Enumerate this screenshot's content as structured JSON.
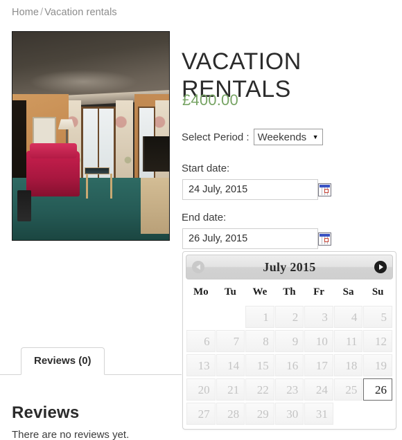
{
  "breadcrumb": {
    "home": "Home",
    "separator": "/",
    "current": "Vacation rentals"
  },
  "product": {
    "title": "VACATION RENTALS",
    "price": "£400.00",
    "price_color": "#77a464",
    "image_alt": "hotel-suite-interior"
  },
  "period": {
    "label": "Select Period :",
    "selected": "Weekends",
    "options": [
      "Weekends"
    ]
  },
  "start_date": {
    "label": "Start date:",
    "value": "24 July, 2015",
    "placeholder": "Start date"
  },
  "end_date": {
    "label": "End date:",
    "value": "26 July, 2015",
    "placeholder": "End date"
  },
  "datepicker": {
    "month_title": "July 2015",
    "prev_label": "Prev",
    "next_label": "Next",
    "weekdays": [
      "Mo",
      "Tu",
      "We",
      "Th",
      "Fr",
      "Sa",
      "Su"
    ],
    "selected_day": "26",
    "weeks": [
      [
        {
          "day": "",
          "state": "empty"
        },
        {
          "day": "",
          "state": "empty"
        },
        {
          "day": "1",
          "state": "disabled"
        },
        {
          "day": "2",
          "state": "disabled"
        },
        {
          "day": "3",
          "state": "disabled"
        },
        {
          "day": "4",
          "state": "disabled"
        },
        {
          "day": "5",
          "state": "disabled"
        }
      ],
      [
        {
          "day": "6",
          "state": "disabled"
        },
        {
          "day": "7",
          "state": "disabled"
        },
        {
          "day": "8",
          "state": "disabled"
        },
        {
          "day": "9",
          "state": "disabled"
        },
        {
          "day": "10",
          "state": "disabled"
        },
        {
          "day": "11",
          "state": "disabled"
        },
        {
          "day": "12",
          "state": "disabled"
        }
      ],
      [
        {
          "day": "13",
          "state": "disabled"
        },
        {
          "day": "14",
          "state": "disabled"
        },
        {
          "day": "15",
          "state": "disabled"
        },
        {
          "day": "16",
          "state": "disabled"
        },
        {
          "day": "17",
          "state": "disabled"
        },
        {
          "day": "18",
          "state": "disabled"
        },
        {
          "day": "19",
          "state": "disabled"
        }
      ],
      [
        {
          "day": "20",
          "state": "disabled"
        },
        {
          "day": "21",
          "state": "disabled"
        },
        {
          "day": "22",
          "state": "disabled"
        },
        {
          "day": "23",
          "state": "disabled"
        },
        {
          "day": "24",
          "state": "disabled"
        },
        {
          "day": "25",
          "state": "disabled"
        },
        {
          "day": "26",
          "state": "active"
        }
      ],
      [
        {
          "day": "27",
          "state": "disabled"
        },
        {
          "day": "28",
          "state": "disabled"
        },
        {
          "day": "29",
          "state": "disabled"
        },
        {
          "day": "30",
          "state": "disabled"
        },
        {
          "day": "31",
          "state": "disabled"
        },
        {
          "day": "",
          "state": "empty"
        },
        {
          "day": "",
          "state": "empty"
        }
      ]
    ]
  },
  "tabs": [
    {
      "label": "Reviews (0)",
      "active": true
    }
  ],
  "reviews": {
    "heading": "Reviews",
    "empty_text": "There are no reviews yet."
  }
}
